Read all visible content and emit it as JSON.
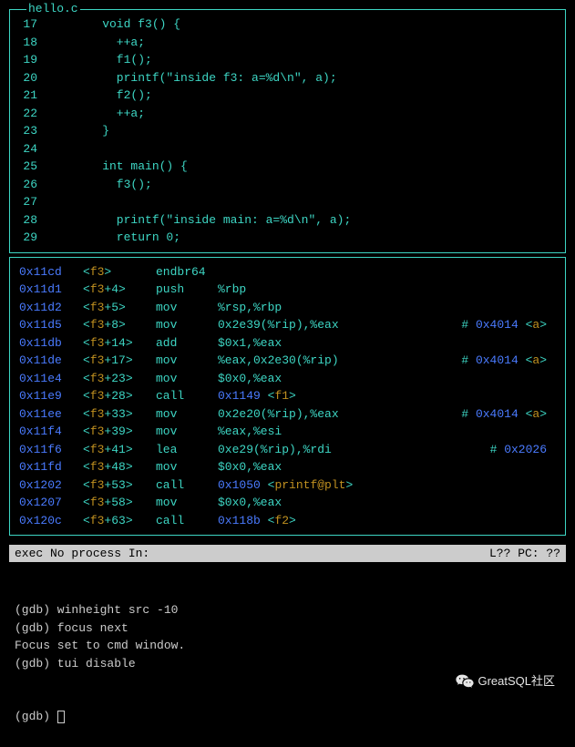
{
  "source_panel": {
    "title": "hello.c",
    "lines": [
      {
        "n": "17",
        "code": "void f3() {"
      },
      {
        "n": "18",
        "code": "  ++a;"
      },
      {
        "n": "19",
        "code": "  f1();"
      },
      {
        "n": "20",
        "code": "  printf(\"inside f3: a=%d\\n\", a);"
      },
      {
        "n": "21",
        "code": "  f2();"
      },
      {
        "n": "22",
        "code": "  ++a;"
      },
      {
        "n": "23",
        "code": "}"
      },
      {
        "n": "24",
        "code": ""
      },
      {
        "n": "25",
        "code": "int main() {"
      },
      {
        "n": "26",
        "code": "  f3();"
      },
      {
        "n": "27",
        "code": ""
      },
      {
        "n": "28",
        "code": "  printf(\"inside main: a=%d\\n\", a);"
      },
      {
        "n": "29",
        "code": "  return 0;"
      }
    ]
  },
  "asm_panel": {
    "lines": [
      {
        "addr": "0x11cd",
        "func": "f3",
        "offset": "",
        "mn": "endbr64",
        "op": "",
        "opblue": "",
        "comment": null
      },
      {
        "addr": "0x11d1",
        "func": "f3",
        "offset": "+4",
        "mn": "push",
        "op": "%rbp",
        "opblue": "",
        "comment": null
      },
      {
        "addr": "0x11d2",
        "func": "f3",
        "offset": "+5",
        "mn": "mov",
        "op": "%rsp,%rbp",
        "opblue": "",
        "comment": null
      },
      {
        "addr": "0x11d5",
        "func": "f3",
        "offset": "+8",
        "mn": "mov",
        "op": "0x2e39(%rip),%eax",
        "opblue": "",
        "comment": {
          "hex": "0x4014",
          "sym": "a"
        }
      },
      {
        "addr": "0x11db",
        "func": "f3",
        "offset": "+14",
        "mn": "add",
        "op": "$0x1,%eax",
        "opblue": "",
        "comment": null
      },
      {
        "addr": "0x11de",
        "func": "f3",
        "offset": "+17",
        "mn": "mov",
        "op": "%eax,0x2e30(%rip)",
        "opblue": "",
        "comment": {
          "hex": "0x4014",
          "sym": "a"
        }
      },
      {
        "addr": "0x11e4",
        "func": "f3",
        "offset": "+23",
        "mn": "mov",
        "op": "$0x0,%eax",
        "opblue": "",
        "comment": null
      },
      {
        "addr": "0x11e9",
        "func": "f3",
        "offset": "+28",
        "mn": "call",
        "op": "",
        "opblue": "0x1149",
        "sym": "f1",
        "comment": null
      },
      {
        "addr": "0x11ee",
        "func": "f3",
        "offset": "+33",
        "mn": "mov",
        "op": "0x2e20(%rip),%eax",
        "opblue": "",
        "comment": {
          "hex": "0x4014",
          "sym": "a"
        }
      },
      {
        "addr": "0x11f4",
        "func": "f3",
        "offset": "+39",
        "mn": "mov",
        "op": "%eax,%esi",
        "opblue": "",
        "comment": null
      },
      {
        "addr": "0x11f6",
        "func": "f3",
        "offset": "+41",
        "mn": "lea",
        "op": "0xe29(%rip),%rdi",
        "opblue": "",
        "comment": {
          "hex": "0x2026",
          "sym": null
        }
      },
      {
        "addr": "0x11fd",
        "func": "f3",
        "offset": "+48",
        "mn": "mov",
        "op": "$0x0,%eax",
        "opblue": "",
        "comment": null
      },
      {
        "addr": "0x1202",
        "func": "f3",
        "offset": "+53",
        "mn": "call",
        "op": "",
        "opblue": "0x1050",
        "sym": "printf@plt",
        "comment": null
      },
      {
        "addr": "0x1207",
        "func": "f3",
        "offset": "+58",
        "mn": "mov",
        "op": "$0x0,%eax",
        "opblue": "",
        "comment": null
      },
      {
        "addr": "0x120c",
        "func": "f3",
        "offset": "+63",
        "mn": "call",
        "op": "",
        "opblue": "0x118b",
        "sym": "f2",
        "comment": null
      }
    ]
  },
  "status": {
    "left": "exec No process In:",
    "right": "L??   PC: ??"
  },
  "cmd": {
    "lines": [
      "(gdb) winheight src -10",
      "(gdb) focus next",
      "Focus set to cmd window.",
      "(gdb) tui disable"
    ],
    "prompt": "(gdb) "
  },
  "watermark": "GreatSQL社区"
}
